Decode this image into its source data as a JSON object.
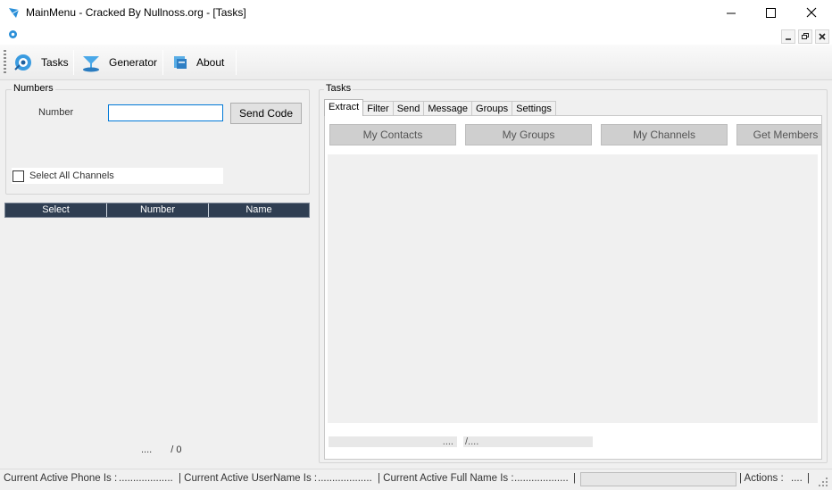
{
  "window": {
    "title": "MainMenu - Cracked By Nullnoss.org - [Tasks]",
    "accent": "#0078d7"
  },
  "toolbar": {
    "items": [
      {
        "label": "Tasks",
        "icon": "tasks-icon"
      },
      {
        "label": "Generator",
        "icon": "generator-icon"
      },
      {
        "label": "About",
        "icon": "about-icon"
      }
    ]
  },
  "numbers": {
    "legend": "Numbers",
    "number_label": "Number",
    "number_value": "",
    "send_code_label": "Send Code",
    "select_all_label": "Select All Channels",
    "select_all_checked": false,
    "columns": [
      "Select",
      "Number",
      "Name"
    ],
    "header_color": "#2f3e52",
    "counter_left": "....",
    "counter_right": "/ 0"
  },
  "tasks": {
    "legend": "Tasks",
    "tabs": [
      "Extract",
      "Filter",
      "Send",
      "Message",
      "Groups",
      "Settings"
    ],
    "active_tab": "Extract",
    "buttons": [
      "My Contacts",
      "My Groups",
      "My Channels",
      "Get Members"
    ],
    "progress_left": "....",
    "progress_right": "/...."
  },
  "statusbar": {
    "phone_label": "Current Active Phone Is :",
    "phone_value": "...................",
    "username_label": "| Current Active UserName Is :",
    "username_value": "...................",
    "fullname_label": "| Current Active Full Name Is :",
    "fullname_value": "...................",
    "actions_label": "| Actions :",
    "actions_value": "....",
    "sep": "|"
  }
}
